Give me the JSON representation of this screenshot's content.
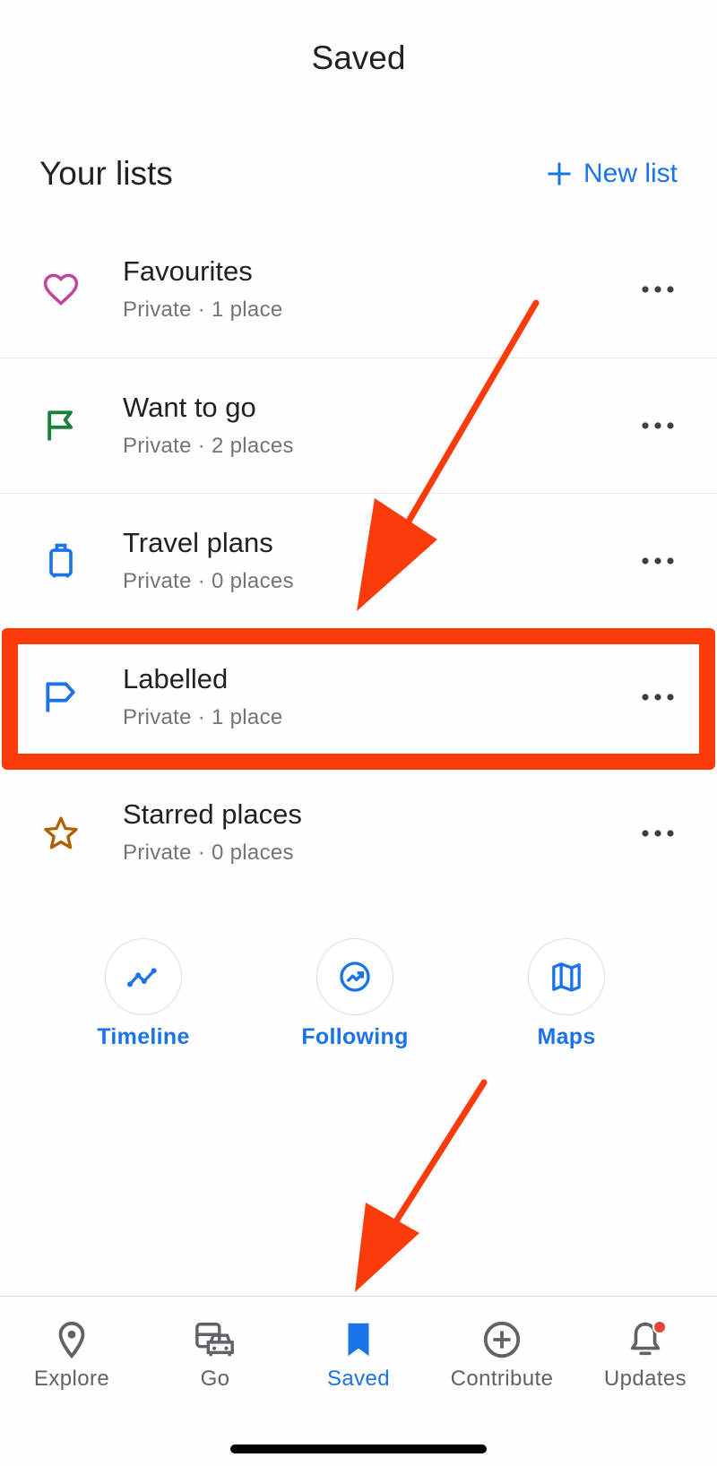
{
  "header": {
    "title": "Saved"
  },
  "lists_section": {
    "title": "Your lists",
    "new_list_label": "New list",
    "new_list_icon": "plus-icon"
  },
  "lists": [
    {
      "name": "Favourites",
      "subtitle": "Private · 1 place",
      "icon": "heart-icon",
      "icon_color": "#c1459b"
    },
    {
      "name": "Want to go",
      "subtitle": "Private · 2 places",
      "icon": "flag-icon",
      "icon_color": "#188038"
    },
    {
      "name": "Travel plans",
      "subtitle": "Private · 0 places",
      "icon": "suitcase-icon",
      "icon_color": "#1a73e8"
    },
    {
      "name": "Labelled",
      "subtitle": "Private · 1 place",
      "icon": "label-flag-icon",
      "icon_color": "#1a73e8"
    },
    {
      "name": "Starred places",
      "subtitle": "Private · 0 places",
      "icon": "star-icon",
      "icon_color": "#b06000"
    }
  ],
  "shortcuts": [
    {
      "label": "Timeline",
      "icon": "timeline-icon"
    },
    {
      "label": "Following",
      "icon": "following-icon"
    },
    {
      "label": "Maps",
      "icon": "map-icon"
    }
  ],
  "bottom_nav": [
    {
      "label": "Explore",
      "icon": "location-pin-icon",
      "active": false
    },
    {
      "label": "Go",
      "icon": "commute-icon",
      "active": false
    },
    {
      "label": "Saved",
      "icon": "bookmark-icon",
      "active": true
    },
    {
      "label": "Contribute",
      "icon": "add-circle-icon",
      "active": false
    },
    {
      "label": "Updates",
      "icon": "bell-icon",
      "active": false,
      "badge": true
    }
  ],
  "colors": {
    "accent": "#1a73e8",
    "annotation": "#fb3c0a",
    "badge": "#ea4335"
  }
}
